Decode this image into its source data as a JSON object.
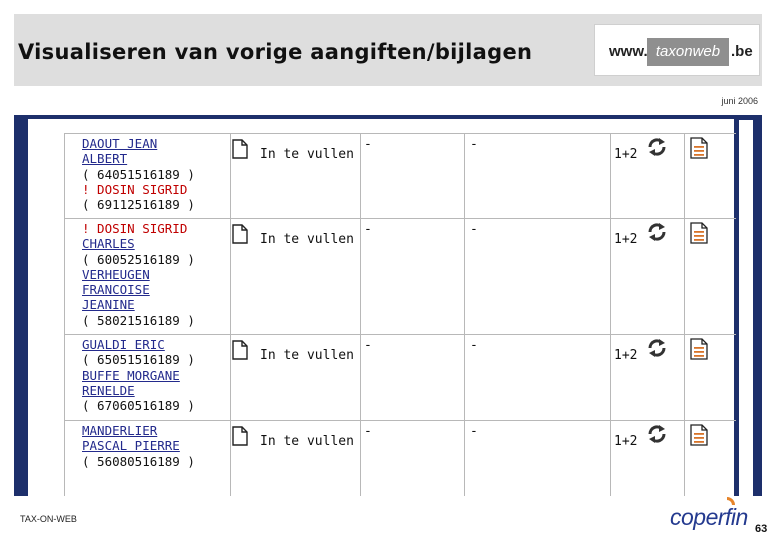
{
  "slide": {
    "title": "Visualiseren van vorige aangiften/bijlagen",
    "date": "juni 2006",
    "footer": "TAX-ON-WEB",
    "page_number": "63",
    "footer_logo": "coperfin"
  },
  "logo": {
    "prefix": "www.",
    "middle": "taxonweb",
    "suffix": ".be"
  },
  "table": {
    "rows": [
      {
        "names": [
          {
            "text": "DAOUT JEAN",
            "style": "link"
          },
          {
            "text": "ALBERT",
            "style": "link"
          },
          {
            "text": "( 64051516189 )",
            "style": "plain"
          },
          {
            "text": "! DOSIN SIGRID",
            "style": "red"
          },
          {
            "text": "( 69112516189 )",
            "style": "plain"
          }
        ],
        "status": "In te vullen",
        "col3": "-",
        "col4": "-",
        "annex": "1+2"
      },
      {
        "names": [
          {
            "text": "! DOSIN SIGRID",
            "style": "red"
          },
          {
            "text": "CHARLES",
            "style": "link"
          },
          {
            "text": "( 60052516189 )",
            "style": "plain"
          },
          {
            "text": "VERHEUGEN",
            "style": "link"
          },
          {
            "text": "FRANCOISE",
            "style": "link"
          },
          {
            "text": "JEANINE",
            "style": "link"
          },
          {
            "text": "( 58021516189 )",
            "style": "plain"
          }
        ],
        "status": "In te vullen",
        "col3": "-",
        "col4": "-",
        "annex": "1+2"
      },
      {
        "names": [
          {
            "text": "GUALDI ERIC",
            "style": "link"
          },
          {
            "text": "( 65051516189 )",
            "style": "plain"
          },
          {
            "text": "BUFFE MORGANE",
            "style": "link"
          },
          {
            "text": "RENELDE",
            "style": "link"
          },
          {
            "text": "( 67060516189 )",
            "style": "plain"
          }
        ],
        "status": "In te vullen",
        "col3": "-",
        "col4": "-",
        "annex": "1+2"
      },
      {
        "names": [
          {
            "text": "MANDERLIER",
            "style": "link"
          },
          {
            "text": "PASCAL PIERRE",
            "style": "link"
          },
          {
            "text": "( 56080516189 )",
            "style": "plain"
          }
        ],
        "status": "In te vullen",
        "col3": "-",
        "col4": "-",
        "annex": "1+2"
      }
    ]
  },
  "icons": {
    "document": "document-icon",
    "refresh": "refresh-icon",
    "pdf": "pdf-icon"
  }
}
